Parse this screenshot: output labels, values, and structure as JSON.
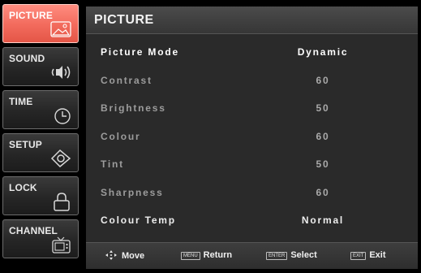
{
  "sidebar": {
    "items": [
      {
        "label": "PICTURE",
        "icon": "picture-icon",
        "active": true
      },
      {
        "label": "SOUND",
        "icon": "speaker-icon",
        "active": false
      },
      {
        "label": "TIME",
        "icon": "clock-icon",
        "active": false
      },
      {
        "label": "SETUP",
        "icon": "eye-icon",
        "active": false
      },
      {
        "label": "LOCK",
        "icon": "padlock-icon",
        "active": false
      },
      {
        "label": "CHANNEL",
        "icon": "tv-icon",
        "active": false
      }
    ]
  },
  "panel": {
    "title": "PICTURE",
    "rows": [
      {
        "label": "Picture Mode",
        "value": "Dynamic"
      },
      {
        "label": "Contrast",
        "value": "60"
      },
      {
        "label": "Brightness",
        "value": "50"
      },
      {
        "label": "Colour",
        "value": "60"
      },
      {
        "label": "Tint",
        "value": "50"
      },
      {
        "label": "Sharpness",
        "value": "60"
      },
      {
        "label": "Colour Temp",
        "value": "Normal"
      }
    ]
  },
  "help": {
    "move": {
      "icon": "move-arrows-icon",
      "label": "Move"
    },
    "return": {
      "key": "MENU",
      "label": "Return"
    },
    "select": {
      "key": "ENTER",
      "label": "Select"
    },
    "exit": {
      "key": "EXIT",
      "label": "Exit"
    }
  },
  "colors": {
    "active_tab": "#f26a5c",
    "panel_bg": "#2a2a2a",
    "background": "#000000"
  }
}
